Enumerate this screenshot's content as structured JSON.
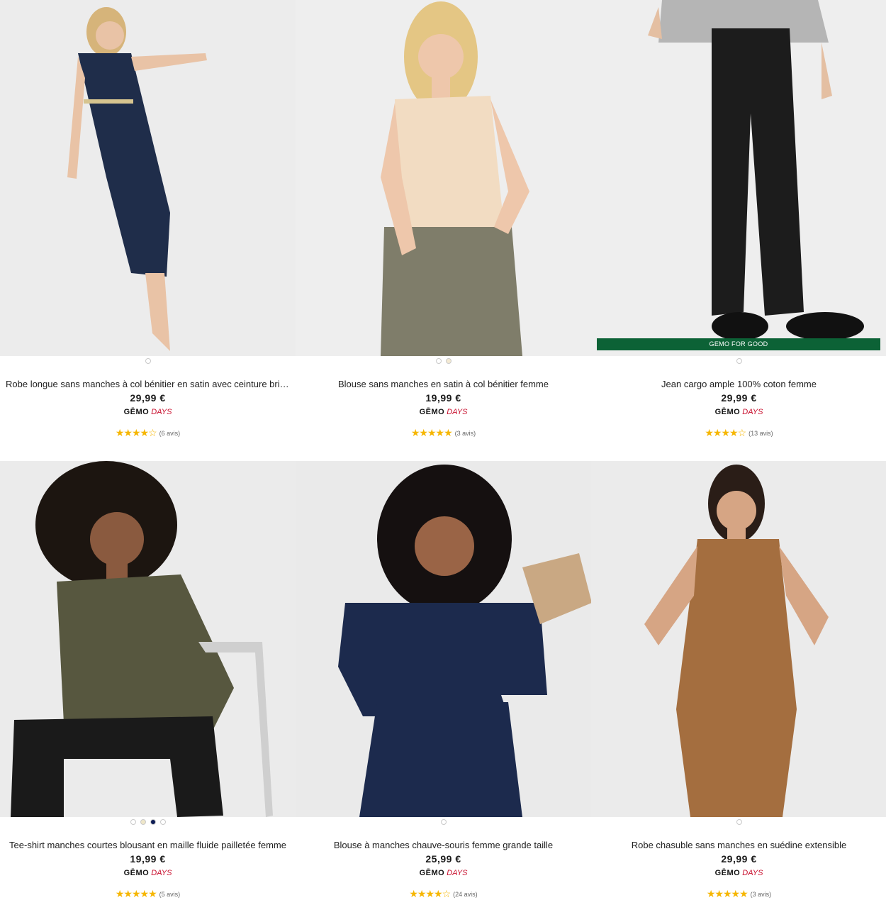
{
  "products": [
    {
      "title": "Robe longue sans manches à col bénitier en satin avec ceinture bril…",
      "price": "29,99 €",
      "promo_brand": "GĒMO",
      "promo_days": "DAYS",
      "stars": "★★★★☆",
      "reviews": "(6 avis)",
      "badge": "",
      "swatches": [
        "#ffffff"
      ],
      "colors": {
        "bg": "#ececec",
        "top": "#1f2d4a",
        "bottom": "#1f2d4a",
        "skin": "#e9c3a6",
        "hair": "#d6b47a"
      }
    },
    {
      "title": "Blouse sans manches en satin à col bénitier femme",
      "price": "19,99 €",
      "promo_brand": "GĒMO",
      "promo_days": "DAYS",
      "stars": "★★★★★",
      "reviews": "(3 avis)",
      "badge": "",
      "swatches": [
        "#ffffff",
        "#f4ead3"
      ],
      "colors": {
        "bg": "#eeeeee",
        "top": "#f2dcc2",
        "bottom": "#7f7d6a",
        "skin": "#eec7ab",
        "hair": "#e4c684"
      }
    },
    {
      "title": "Jean cargo ample 100% coton femme",
      "price": "29,99 €",
      "promo_brand": "GĒMO",
      "promo_days": "DAYS",
      "stars": "★★★★☆",
      "reviews": "(13 avis)",
      "badge": "GEMO FOR GOOD",
      "badge_color": "#0c6236",
      "swatches": [
        "#ffffff"
      ],
      "colors": {
        "bg": "#eeeeee",
        "top": "#b5b5b5",
        "bottom": "#1c1c1c",
        "skin": "#e4bfa2",
        "hair": "#e4bfa2"
      }
    },
    {
      "title": "Tee-shirt manches courtes blousant en maille fluide pailletée femme",
      "price": "19,99 €",
      "promo_brand": "GĒMO",
      "promo_days": "DAYS",
      "stars": "★★★★★",
      "reviews": "(5 avis)",
      "badge": "",
      "swatches": [
        "#ffffff",
        "#efe7c9",
        "#0d1c55",
        "#ffffff"
      ],
      "colors": {
        "bg": "#ebebeb",
        "top": "#57573f",
        "bottom": "#1a1a1a",
        "skin": "#8a5a3f",
        "hair": "#1c1510"
      }
    },
    {
      "title": "Blouse à manches chauve-souris femme grande taille",
      "price": "25,99 €",
      "promo_brand": "GĒMO",
      "promo_days": "DAYS",
      "stars": "★★★★☆",
      "reviews": "(24 avis)",
      "badge": "",
      "swatches": [
        "#ffffff"
      ],
      "colors": {
        "bg": "#eaeaea",
        "top": "#1c2a4d",
        "bottom": "#1c2a4d",
        "skin": "#9a6446",
        "hair": "#151010"
      }
    },
    {
      "title": "Robe chasuble sans manches en suédine extensible",
      "price": "29,99 €",
      "promo_brand": "GĒMO",
      "promo_days": "DAYS",
      "stars": "★★★★★",
      "reviews": "(3 avis)",
      "badge": "",
      "swatches": [
        "#ffffff"
      ],
      "colors": {
        "bg": "#ebebeb",
        "top": "#a46e3f",
        "bottom": "#a46e3f",
        "skin": "#d6a584",
        "hair": "#2a1d17"
      }
    }
  ]
}
